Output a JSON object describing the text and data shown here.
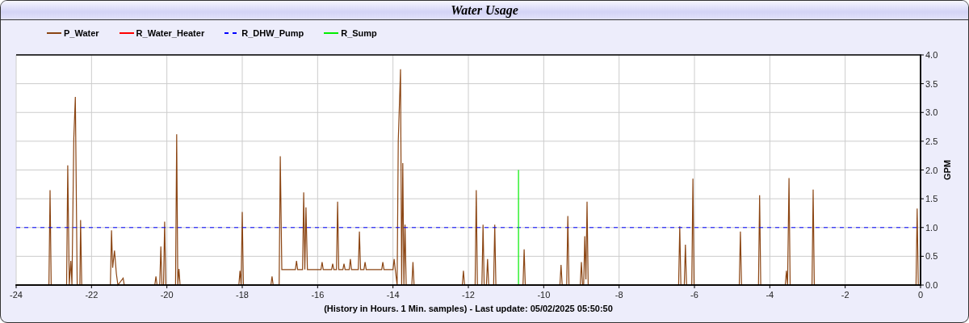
{
  "panel": {
    "title": "Water Usage"
  },
  "chart_data": {
    "type": "line",
    "grid": true,
    "xlabel": "(History in Hours. 1 Min. samples) - Last update: 05/02/2025 05:50:50",
    "ylabel": "GPM",
    "xlim": [
      -24,
      0
    ],
    "ylim": [
      0,
      4
    ],
    "xticks": [
      -24,
      -22,
      -20,
      -18,
      -16,
      -14,
      -12,
      -10,
      -8,
      -6,
      -4,
      -2,
      0
    ],
    "yticks": [
      {
        "value": 0,
        "label": "0.0"
      },
      {
        "value": 0.5,
        "label": "0.5"
      },
      {
        "value": 1,
        "label": "1.0"
      },
      {
        "value": 1.5,
        "label": "1.5"
      },
      {
        "value": 2,
        "label": "2.0"
      },
      {
        "value": 2.5,
        "label": "2.5"
      },
      {
        "value": 3,
        "label": "3.0"
      },
      {
        "value": 3.5,
        "label": "3.5"
      },
      {
        "value": 4,
        "label": "4.0"
      }
    ],
    "series": [
      {
        "name": "P_Water",
        "color": "#8b4513",
        "line_style": "solid",
        "x": [
          -24,
          -23.13,
          -23.1,
          -23.07,
          -22.66,
          -22.63,
          -22.59,
          -22.55,
          -22.52,
          -22.47,
          -22.43,
          -22.38,
          -22.31,
          -22.29,
          -22.26,
          -21.5,
          -21.47,
          -21.44,
          -21.39,
          -21.34,
          -21.3,
          -21.16,
          -21.13,
          -20.32,
          -20.29,
          -20.26,
          -20.19,
          -20.16,
          -20.13,
          -20.09,
          -20.06,
          -20.03,
          -19.77,
          -19.74,
          -19.71,
          -19.68,
          -19.65,
          -18.09,
          -18.06,
          -18.03,
          -18,
          -17.97,
          -17.24,
          -17.21,
          -17.18,
          -17.02,
          -16.99,
          -16.95,
          -16.59,
          -16.56,
          -16.53,
          -16.4,
          -16.37,
          -16.34,
          -16.31,
          -16.27,
          -15.91,
          -15.88,
          -15.85,
          -15.63,
          -15.6,
          -15.57,
          -15.5,
          -15.47,
          -15.44,
          -15.33,
          -15.3,
          -15.27,
          -15.16,
          -15.13,
          -15.1,
          -14.92,
          -14.89,
          -14.86,
          -14.77,
          -14.74,
          -14.71,
          -14.3,
          -14.27,
          -14.24,
          -14,
          -13.97,
          -13.94,
          -13.89,
          -13.86,
          -13.8,
          -13.77,
          -13.74,
          -13.71,
          -13.68,
          -13.65,
          -13.5,
          -13.47,
          -13.44,
          -12.16,
          -12.13,
          -12.1,
          -11.82,
          -11.79,
          -11.76,
          -11.64,
          -11.61,
          -11.58,
          -11.52,
          -11.49,
          -11.46,
          -11.33,
          -11.3,
          -11.27,
          -10.55,
          -10.52,
          -10.49,
          -9.57,
          -9.54,
          -9.51,
          -9.39,
          -9.36,
          -9.33,
          -9.03,
          -9,
          -8.97,
          -8.94,
          -8.91,
          -8.88,
          -8.85,
          -8.82,
          -6.42,
          -6.39,
          -6.36,
          -6.27,
          -6.24,
          -6.21,
          -6.07,
          -6.04,
          -6.01,
          -4.81,
          -4.78,
          -4.75,
          -4.3,
          -4.27,
          -4.24,
          -3.59,
          -3.56,
          -3.53,
          -3.49,
          -3.46,
          -2.88,
          -2.85,
          -2.82,
          -0.12,
          -0.09,
          -0.06,
          0
        ],
        "values": [
          0,
          0,
          1.65,
          0,
          0,
          2.08,
          0,
          0.42,
          0,
          2.55,
          3.27,
          0,
          0,
          1.13,
          0,
          0,
          0.95,
          0.3,
          0.6,
          0.2,
          0,
          0.12,
          0,
          0,
          0.15,
          0,
          0,
          0.67,
          0,
          0,
          1.1,
          0,
          0,
          2.62,
          0,
          0.28,
          0,
          0,
          0.25,
          0,
          1.27,
          0,
          0,
          0.15,
          0,
          0,
          2.24,
          0.27,
          0.27,
          0.42,
          0.27,
          0.27,
          1.61,
          0.27,
          1.35,
          0.27,
          0.27,
          0.4,
          0.27,
          0.27,
          0.37,
          0.27,
          0.27,
          1.45,
          0.27,
          0.27,
          0.37,
          0.27,
          0.27,
          0.45,
          0.27,
          0.27,
          0.93,
          0.27,
          0.27,
          0.4,
          0.27,
          0.27,
          0.4,
          0.27,
          0.27,
          0.45,
          0.27,
          0,
          2.5,
          3.75,
          0,
          2.12,
          0,
          1.05,
          0,
          0,
          0.4,
          0,
          0,
          0.25,
          0,
          0,
          1.65,
          0,
          0,
          1.05,
          0,
          0,
          0.45,
          0,
          0,
          1.05,
          0,
          0,
          0.62,
          0,
          0,
          0.35,
          0,
          0,
          1.2,
          0,
          0,
          0.4,
          0,
          0,
          0.85,
          0.1,
          1.45,
          0,
          0,
          1.02,
          0,
          0,
          0.7,
          0,
          0,
          1.85,
          0,
          0,
          0.93,
          0,
          0,
          1.56,
          0,
          0,
          0.25,
          0,
          1.86,
          0,
          0,
          1.66,
          0,
          0,
          1.33,
          0,
          0
        ]
      },
      {
        "name": "R_Water_Heater",
        "color": "#ff0000",
        "line_style": "solid"
      },
      {
        "name": "R_DHW_Pump",
        "color": "#0000ff",
        "line_style": "dashed",
        "x": [
          -24,
          0
        ],
        "values": [
          1,
          1
        ]
      },
      {
        "name": "R_Sump",
        "color": "#00ee00",
        "line_style": "solid",
        "x": [
          -10.67,
          -10.67
        ],
        "values": [
          0,
          2
        ]
      }
    ]
  }
}
